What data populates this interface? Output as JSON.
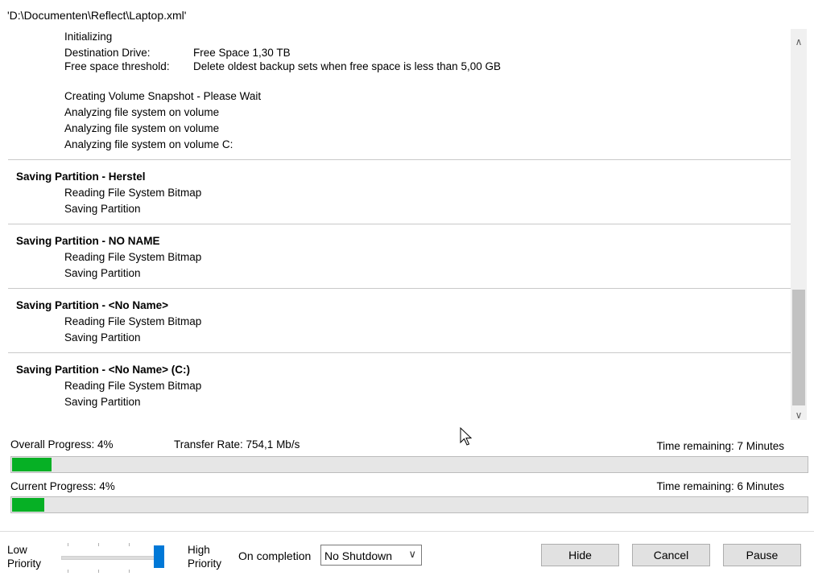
{
  "window_title": "'D:\\Documenten\\Reflect\\Laptop.xml'",
  "log": {
    "init": {
      "initializing": "Initializing",
      "dest_label": "Destination Drive:",
      "dest_value": "Free Space 1,30 TB",
      "threshold_label": "Free space threshold:",
      "threshold_value": "Delete oldest backup sets when free space is less than 5,00 GB",
      "snapshot": "Creating Volume Snapshot - Please Wait",
      "analyze1": "Analyzing file system on volume",
      "analyze2": "Analyzing file system on volume",
      "analyze3": "Analyzing file system on volume C:"
    },
    "sections": [
      {
        "title": "Saving Partition - Herstel",
        "step1": "Reading File System Bitmap",
        "step2": "Saving Partition"
      },
      {
        "title": "Saving Partition - NO NAME",
        "step1": "Reading File System Bitmap",
        "step2": "Saving Partition"
      },
      {
        "title": "Saving Partition - <No Name>",
        "step1": "Reading File System Bitmap",
        "step2": "Saving Partition"
      },
      {
        "title": "Saving Partition - <No Name> (C:)",
        "step1": "Reading File System Bitmap",
        "step2": "Saving Partition"
      }
    ]
  },
  "progress": {
    "overall_label": "Overall Progress:  4%",
    "overall_fraction": 0.04,
    "transfer_rate": "Transfer Rate: 754,1 Mb/s",
    "overall_remaining": "Time remaining: 7 Minutes",
    "current_label": "Current Progress:  4%",
    "current_fraction": 0.04,
    "current_remaining": "Time remaining: 6 Minutes",
    "fill_color": "#06b025"
  },
  "footer": {
    "low_priority": "Low\nPriority",
    "low1": "Low",
    "low2": "Priority",
    "high1": "High",
    "high2": "Priority",
    "priority_level": 1.0,
    "on_completion_label": "On completion",
    "on_completion_value": "No Shutdown",
    "hide": "Hide",
    "cancel": "Cancel",
    "pause": "Pause"
  }
}
